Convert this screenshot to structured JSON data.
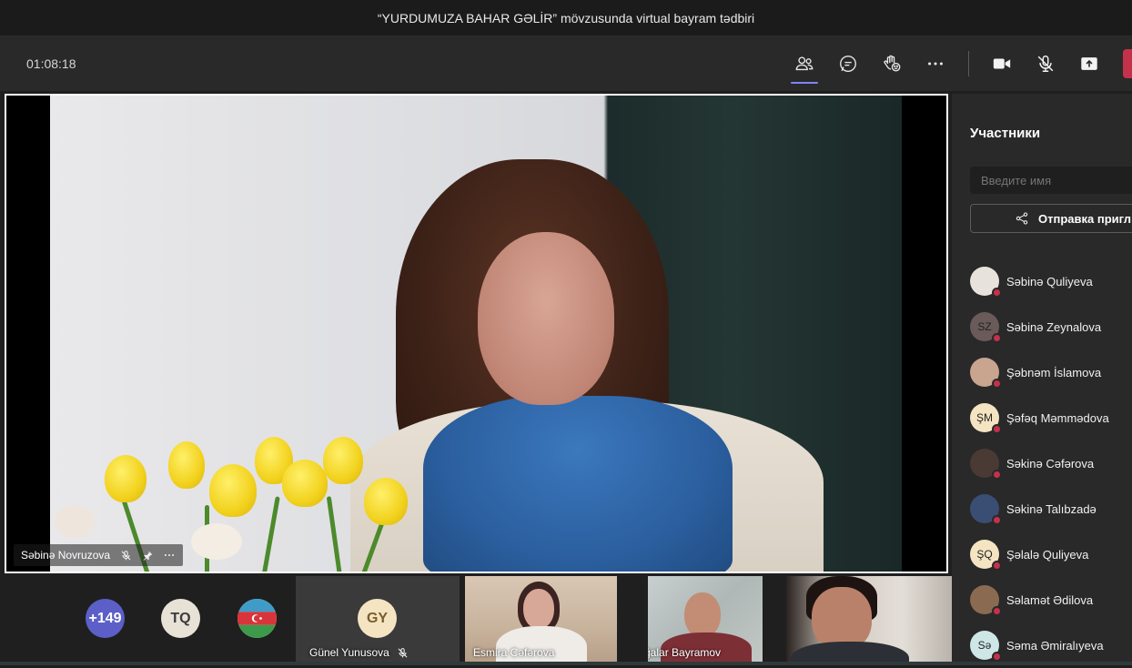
{
  "meeting": {
    "title": "“YURDUMUZA BAHAR GƏLİR” mövzusunda virtual bayram tədbiri",
    "elapsed": "01:08:18"
  },
  "toolbar": {
    "buttons": [
      {
        "name": "participants",
        "icon": "people-icon"
      },
      {
        "name": "chat",
        "icon": "chat-icon"
      },
      {
        "name": "raise-hand",
        "icon": "hand-icon"
      },
      {
        "name": "more",
        "icon": "more-icon"
      },
      {
        "name": "camera",
        "icon": "camera-icon"
      },
      {
        "name": "mic",
        "icon": "mic-off-icon"
      },
      {
        "name": "share",
        "icon": "share-screen-icon"
      }
    ],
    "leave_color": "#c4314b"
  },
  "stage": {
    "speaker_name": "Səbinə Novruzova"
  },
  "strip": {
    "overflow_count": "+149",
    "tq_initials": "TQ",
    "gy_initials": "GY",
    "gunel": "Günel Yunusova",
    "esmira": "Esmira Cəfərova",
    "agalar": "Ağalar Bayramov"
  },
  "panel": {
    "title": "Участники",
    "search_placeholder": "Введите имя",
    "share_label": "Отправка пригл",
    "participants": [
      {
        "name": "Səbinə Quliyeva",
        "initials": "",
        "color": "#e8e2dc"
      },
      {
        "name": "Səbinə Zeynalova",
        "initials": "SZ",
        "color": "#6b5a5a"
      },
      {
        "name": "Şəbnəm İslamova",
        "initials": "",
        "color": "#c9a48f"
      },
      {
        "name": "Şəfəq Məmmədova",
        "initials": "ŞM",
        "color": "#f4e4c1"
      },
      {
        "name": "Səkinə Cəfərova",
        "initials": "",
        "color": "#4a3a34"
      },
      {
        "name": "Səkinə Talıbzadə",
        "initials": "",
        "color": "#3a4e73"
      },
      {
        "name": "Şəlalə Quliyeva",
        "initials": "ŞQ",
        "color": "#f4e4c1"
      },
      {
        "name": "Səlamət Ədilova",
        "initials": "",
        "color": "#8a6b52"
      },
      {
        "name": "Səma Əmiralıyeva",
        "initials": "Sə",
        "color": "#cfe6e6"
      }
    ]
  }
}
